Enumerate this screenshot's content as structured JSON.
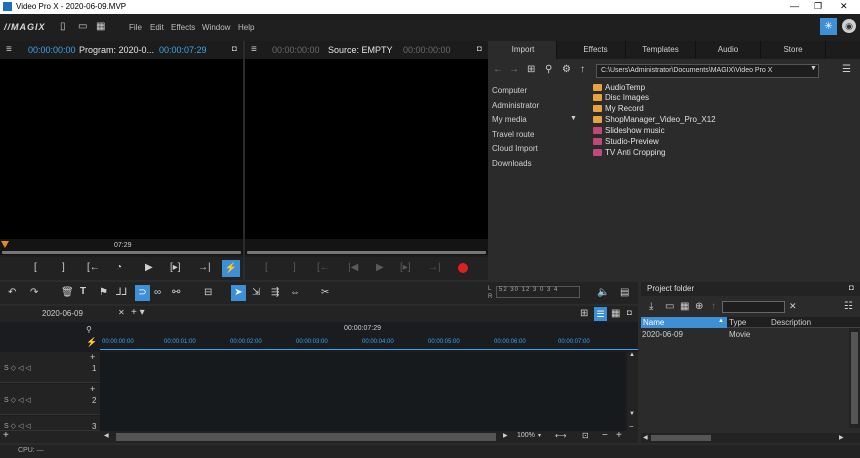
{
  "window": {
    "title": "Video Pro X - 2020-06-09.MVP"
  },
  "menu": {
    "brand": "//MAGIX",
    "items": [
      "File",
      "Edit",
      "Effects",
      "Window",
      "Help"
    ]
  },
  "program_monitor": {
    "timecode_left": "00:00:00:00",
    "label": "Program: 2020-0...",
    "timecode_right": "00:00:07:29",
    "ruler_time": "07:29"
  },
  "source_monitor": {
    "timecode_left": "00:00:00:00",
    "label": "Source: EMPTY",
    "timecode_right": "00:00:00:00"
  },
  "import_tabs": [
    "Import",
    "Effects",
    "Templates",
    "Audio",
    "Store"
  ],
  "import": {
    "path": "C:\\Users\\Administrator\\Documents\\MAGIX\\Video Pro X",
    "sidebar": [
      "Computer",
      "Administrator",
      "My media",
      "Travel route",
      "Cloud Import",
      "Downloads"
    ],
    "files": [
      "AudioTemp",
      "Disc Images",
      "My Record",
      "ShopManager_Video_Pro_X12",
      "Slideshow music",
      "Studio-Preview",
      "TV Anti Cropping"
    ],
    "folder_colors": [
      "#e8a33d",
      "#e8a33d",
      "#e8a33d",
      "#e8a33d",
      "#c0487a",
      "#c0487a",
      "#c0487a"
    ]
  },
  "meter_scale": [
    "52",
    "30",
    "12",
    "3",
    "0",
    "3",
    "4"
  ],
  "meter_label": "L\nR",
  "timeline": {
    "tab": "2020-06-09",
    "timecode": "00:00:07:29",
    "ticks": [
      "00:00:00:00",
      "00:00:01:00",
      "00:00:02:00",
      "00:00:03:00",
      "00:00:04:00",
      "00:00:05:00",
      "00:00:06:00",
      "00:00:07:00"
    ],
    "tracks": [
      "1",
      "2",
      "3"
    ],
    "track_controls": "S ◇ ◁ ◁",
    "zoom": "100%"
  },
  "project_folder": {
    "title": "Project folder",
    "columns": [
      "Name",
      "Type",
      "Description"
    ],
    "rows": [
      {
        "name": "2020-06-09",
        "type": "Movie",
        "desc": ""
      }
    ]
  },
  "status": {
    "cpu": "CPU: —"
  }
}
